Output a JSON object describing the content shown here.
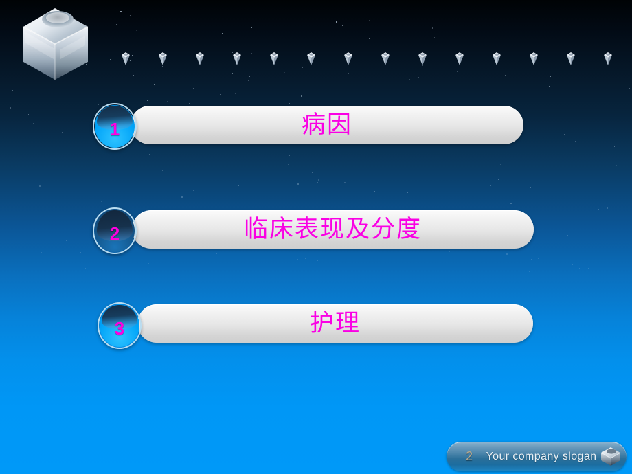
{
  "slide": {
    "background_top_color": "#000305",
    "background_bottom_color": "#0099f8",
    "accent_magenta": "#ff00e0",
    "accent_cyan": "#00a3f8"
  },
  "header": {
    "logo_icon": "chrome-cube-logo-icon",
    "gem_icon": "gem-icon",
    "gem_count": 14
  },
  "agenda": {
    "items": [
      {
        "number": "1",
        "label": "病因",
        "badge_style": "bright"
      },
      {
        "number": "2",
        "label": "临床表现及分度",
        "badge_style": "dark"
      },
      {
        "number": "3",
        "label": "护理",
        "badge_style": "bright"
      }
    ]
  },
  "footer": {
    "page_number": "2",
    "slogan": "Your company slogan",
    "cube_icon": "cube-icon"
  }
}
